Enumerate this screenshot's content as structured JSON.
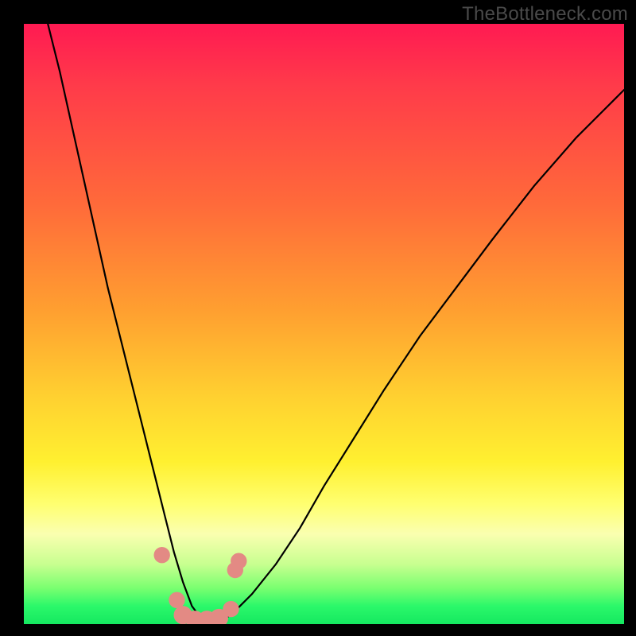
{
  "watermark": "TheBottleneck.com",
  "colors": {
    "bg": "#000000",
    "watermark": "#4a4a4a",
    "curve": "#000000",
    "marker_fill": "#e38a84",
    "marker_stroke": "#d47a74"
  },
  "chart_data": {
    "type": "line",
    "title": "",
    "xlabel": "",
    "ylabel": "",
    "xlim": [
      0,
      100
    ],
    "ylim": [
      0,
      100
    ],
    "note": "Axis is unlabeled; values below are estimated percentages of the plot area. y=0 at bottom, x=0 at left.",
    "series": [
      {
        "name": "v-curve",
        "x": [
          4,
          6,
          8,
          10,
          12,
          14,
          16,
          18,
          20,
          22,
          23.5,
          25,
          26.5,
          28,
          29.5,
          31,
          33,
          35,
          38,
          42,
          46,
          50,
          55,
          60,
          66,
          72,
          78,
          85,
          92,
          100
        ],
        "y": [
          100,
          92,
          83,
          74,
          65,
          56,
          48,
          40,
          32,
          24,
          18,
          12,
          7,
          3,
          1,
          0,
          0.5,
          2,
          5,
          10,
          16,
          23,
          31,
          39,
          48,
          56,
          64,
          73,
          81,
          89
        ]
      }
    ],
    "markers": [
      {
        "x": 23.0,
        "y": 11.5,
        "r": 1.5
      },
      {
        "x": 25.5,
        "y": 4.0,
        "r": 1.5
      },
      {
        "x": 26.5,
        "y": 1.5,
        "r": 1.7
      },
      {
        "x": 28.5,
        "y": 0.7,
        "r": 1.7
      },
      {
        "x": 30.5,
        "y": 0.7,
        "r": 1.7
      },
      {
        "x": 32.5,
        "y": 1.0,
        "r": 1.7
      },
      {
        "x": 34.5,
        "y": 2.5,
        "r": 1.5
      },
      {
        "x": 35.2,
        "y": 9.0,
        "r": 1.5
      },
      {
        "x": 35.8,
        "y": 10.5,
        "r": 1.5
      }
    ]
  }
}
